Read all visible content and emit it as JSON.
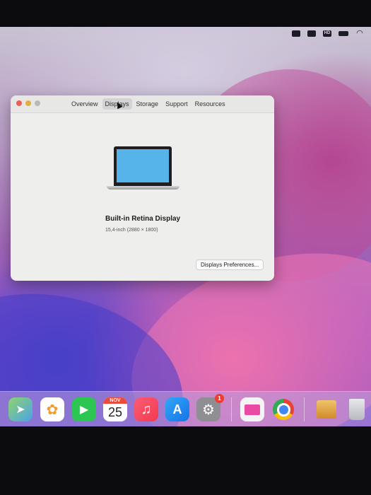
{
  "window": {
    "tabs": [
      "Overview",
      "Displays",
      "Storage",
      "Support",
      "Resources"
    ],
    "active_tab": "Displays",
    "display_name": "Built-in Retina Display",
    "display_spec": "15,4-inch (2880 × 1800)",
    "preferences_button": "Displays Preferences..."
  },
  "menubar": {
    "icons": [
      "text-input-icon",
      "screen-mirroring-icon",
      "hd-badge-icon",
      "battery-icon",
      "wifi-icon"
    ],
    "hd_label": "HD"
  },
  "dock": {
    "apps": [
      "maps",
      "photos",
      "facetime",
      "calendar",
      "music",
      "app-store",
      "system-preferences",
      "monitor-app",
      "chrome",
      "installer-package",
      "trash"
    ],
    "calendar_month": "NOV",
    "calendar_day": "25",
    "settings_badge": "1"
  },
  "colors": {
    "display_screen": "#57b4ea",
    "badge": "#ef3b32"
  }
}
